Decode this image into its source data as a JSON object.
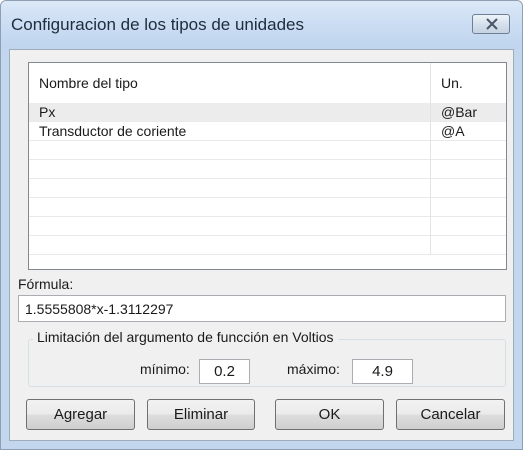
{
  "window": {
    "title": "Configuracion de los tipos de unidades",
    "close_icon": "close-x-icon"
  },
  "list": {
    "columns": [
      "Nombre del tipo",
      "Un."
    ],
    "rows": [
      {
        "name": "Px",
        "unit": "@Bar",
        "selected": true
      },
      {
        "name": "Transductor de coriente",
        "unit": "@A",
        "selected": false
      },
      {
        "name": "",
        "unit": "",
        "selected": false
      },
      {
        "name": "",
        "unit": "",
        "selected": false
      },
      {
        "name": "",
        "unit": "",
        "selected": false
      },
      {
        "name": "",
        "unit": "",
        "selected": false
      },
      {
        "name": "",
        "unit": "",
        "selected": false
      },
      {
        "name": "",
        "unit": "",
        "selected": false
      }
    ]
  },
  "formula": {
    "label": "Fórmula:",
    "value": "1.5555808*x-1.3112297"
  },
  "limits": {
    "legend": "Limitación del argumento de funcción en Voltios",
    "min_label": "mínimo:",
    "min_value": "0.2",
    "max_label": "máximo:",
    "max_value": "4.9"
  },
  "buttons": {
    "add": "Agregar",
    "delete": "Eliminar",
    "ok": "OK",
    "cancel": "Cancelar"
  },
  "colors": {
    "title_bar": "#c9dcf2",
    "client_bg": "#f0f0f0",
    "selected_row": "#ececec"
  }
}
